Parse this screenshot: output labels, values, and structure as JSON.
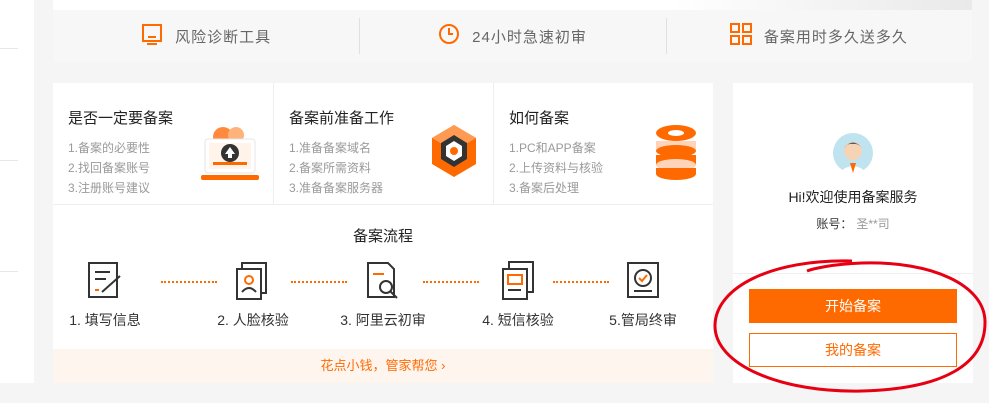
{
  "features": [
    {
      "label": "风险诊断工具",
      "icon": "monitor-icon"
    },
    {
      "label": "24小时急速初审",
      "icon": "clock-icon"
    },
    {
      "label": "备案用时多久送多久",
      "icon": "grid-icon"
    }
  ],
  "topics": [
    {
      "title": "是否一定要备案",
      "items": [
        "1.备案的必要性",
        "2.找回备案账号",
        "3.注册账号建议"
      ],
      "icon": "upload-laptop-icon"
    },
    {
      "title": "备案前准备工作",
      "items": [
        "1.准备备案域名",
        "2.备案所需资料",
        "3.准备备案服务器"
      ],
      "icon": "hexagon-box-icon"
    },
    {
      "title": "如何备案",
      "items": [
        "1.PC和APP备案",
        "2.上传资料与核验",
        "3.备案后处理"
      ],
      "icon": "server-stack-icon"
    }
  ],
  "flow": {
    "title": "备案流程",
    "steps": [
      {
        "label": "1. 填写信息",
        "icon": "form-edit-icon"
      },
      {
        "label": "2. 人脸核验",
        "icon": "face-verify-icon"
      },
      {
        "label": "3. 阿里云初审",
        "icon": "document-search-icon"
      },
      {
        "label": "4. 短信核验",
        "icon": "sms-verify-icon"
      },
      {
        "label": "5.管局终审",
        "icon": "approval-check-icon"
      }
    ],
    "promo": "花点小钱，管家帮您 ›"
  },
  "panel": {
    "greeting": "Hi!欢迎使用备案服务",
    "account_label": "账号：",
    "account_value": "圣**司",
    "start_button": "开始备案",
    "my_button": "我的备案"
  },
  "colors": {
    "accent": "#ff6a00",
    "annotation": "#e60012"
  }
}
